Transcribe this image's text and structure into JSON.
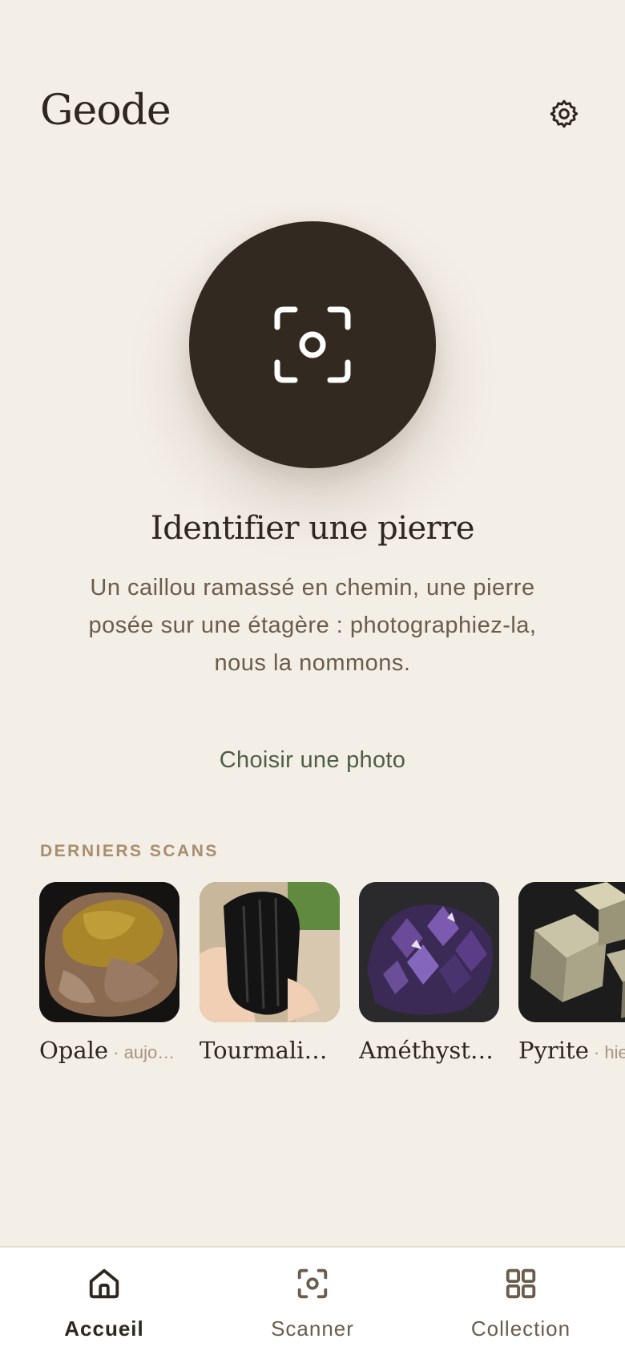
{
  "header": {
    "title": "Geode",
    "settings_icon": "gear-icon"
  },
  "hero": {
    "scan_icon": "scan-camera-icon",
    "title": "Identifier une pierre",
    "description": "Un caillou ramassé en chemin, une pierre posée sur une étagère : photographiez-la, nous la nommons.",
    "choose_photo": "Choisir une photo"
  },
  "recent": {
    "label": "DERNIERS SCANS",
    "items": [
      {
        "name": "Opale",
        "sep": " · ",
        "when": "aujo…"
      },
      {
        "name": "Tourmalin…",
        "sep": "",
        "when": ""
      },
      {
        "name": "Améthyste…",
        "sep": "",
        "when": ""
      },
      {
        "name": "Pyrite",
        "sep": " · ",
        "when": "hie"
      }
    ]
  },
  "nav": {
    "items": [
      {
        "label": "Accueil",
        "icon": "home-icon",
        "active": true
      },
      {
        "label": "Scanner",
        "icon": "scan-icon",
        "active": false
      },
      {
        "label": "Collection",
        "icon": "grid-icon",
        "active": false
      }
    ]
  },
  "colors": {
    "background": "#f3eee6",
    "primary_dark": "#322a20",
    "accent_green": "#4d5e45",
    "label_tan": "#a88d6e"
  }
}
